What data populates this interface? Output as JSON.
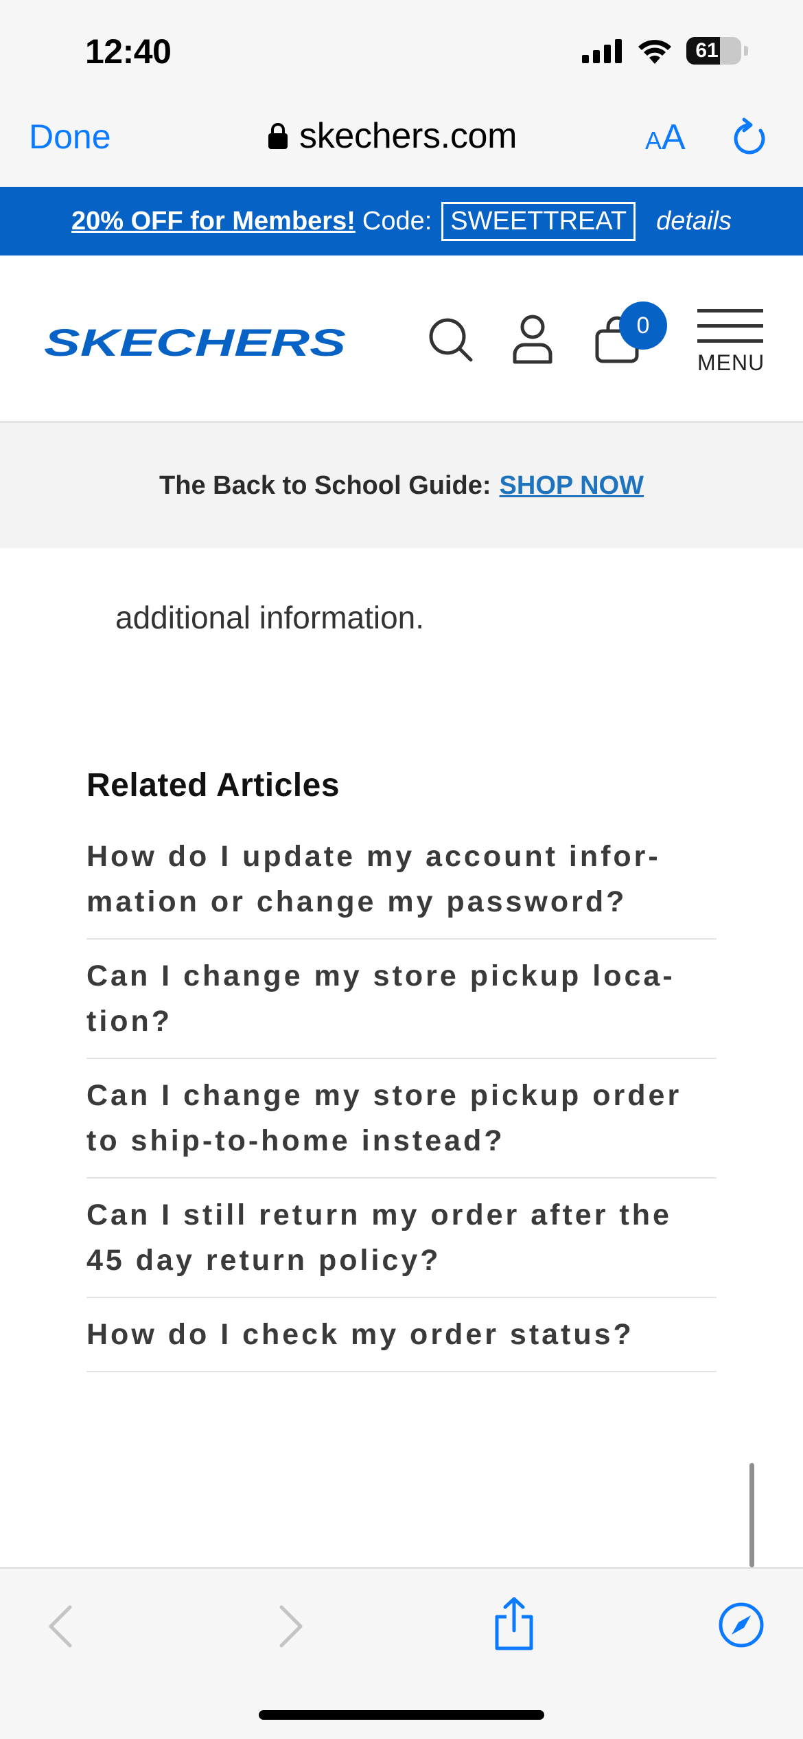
{
  "status_bar": {
    "time": "12:40",
    "battery": "61",
    "battery_level_percent": 61
  },
  "browser": {
    "done_label": "Done",
    "url": "skechers.com",
    "text_size_small": "A",
    "text_size_large": "A"
  },
  "promo": {
    "link_text": "20% OFF for Members!",
    "code_label": "Code:",
    "code": "SWEETTREAT",
    "details": "details"
  },
  "header": {
    "logo_text": "SKECHERS",
    "cart_count": "0",
    "menu_label": "MENU"
  },
  "school_strip": {
    "text": "The Back to School Guide:",
    "link": "SHOP NOW"
  },
  "article": {
    "intro_text": "additional information.",
    "related_heading": "Related Articles",
    "related": [
      {
        "title": "How do I update my account infor-mation or change my password?"
      },
      {
        "title": "Can I change my store pickup loca-tion?"
      },
      {
        "title": "Can I change my store pickup order to ship-to-home instead?"
      },
      {
        "title": "Can I still return my order after the 45 day return policy?"
      },
      {
        "title": "How do I check my order status?"
      }
    ]
  },
  "colors": {
    "brand_blue": "#0762c6",
    "ios_blue": "#0b7aff",
    "link_blue": "#1e73be"
  },
  "icons": [
    "lock-icon",
    "reload-icon",
    "search-icon",
    "account-icon",
    "bag-icon",
    "hamburger-icon",
    "back-icon",
    "forward-icon",
    "share-icon",
    "compass-icon"
  ]
}
